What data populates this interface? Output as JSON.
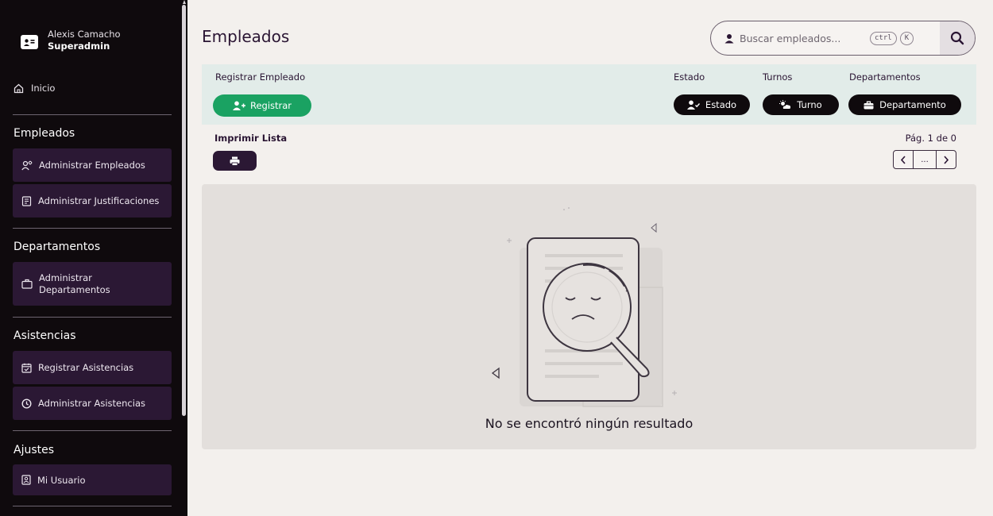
{
  "user": {
    "name": "Alexis Camacho",
    "role": "Superadmin",
    "icon": "id-card-icon"
  },
  "sidebar": {
    "home_label": "Inicio",
    "sections": [
      {
        "title": "Empleados",
        "items": [
          {
            "label": "Administrar Empleados",
            "icon": "users-cog-icon"
          },
          {
            "label": "Administrar Justificaciones",
            "icon": "document-icon"
          }
        ]
      },
      {
        "title": "Departamentos",
        "items": [
          {
            "label": "Administrar Departamentos",
            "line1": "Administrar",
            "line2": "Departamentos",
            "icon": "briefcase-icon"
          }
        ]
      },
      {
        "title": "Asistencias",
        "items": [
          {
            "label": "Registrar Asistencias",
            "icon": "calendar-check-icon"
          },
          {
            "label": "Administrar Asistencias",
            "icon": "clock-icon"
          }
        ]
      },
      {
        "title": "Ajustes",
        "items": [
          {
            "label": "Mi Usuario",
            "icon": "user-badge-icon"
          }
        ]
      }
    ]
  },
  "header": {
    "title": "Empleados",
    "search_placeholder": "Buscar empleados...",
    "shortcut_ctrl": "ctrl",
    "shortcut_key": "K"
  },
  "filters": {
    "register_label": "Registrar Empleado",
    "register_button": "Registrar",
    "estado_label": "Estado",
    "estado_button": "Estado",
    "turnos_label": "Turnos",
    "turno_button": "Turno",
    "departamentos_label": "Departamentos",
    "departamento_button": "Departamento"
  },
  "list": {
    "print_label": "Imprimir Lista",
    "page_info": "Pág. 1 de 0",
    "pager_middle": "..."
  },
  "empty_state": {
    "message": "No se encontró ningún resultado"
  },
  "colors": {
    "sidebar_bg": "#0f0a0d",
    "nav_item_bg": "#2b1834",
    "accent_green": "#1aa262",
    "filter_bar_bg": "#e2ece9",
    "page_bg": "#f3f0ed"
  }
}
